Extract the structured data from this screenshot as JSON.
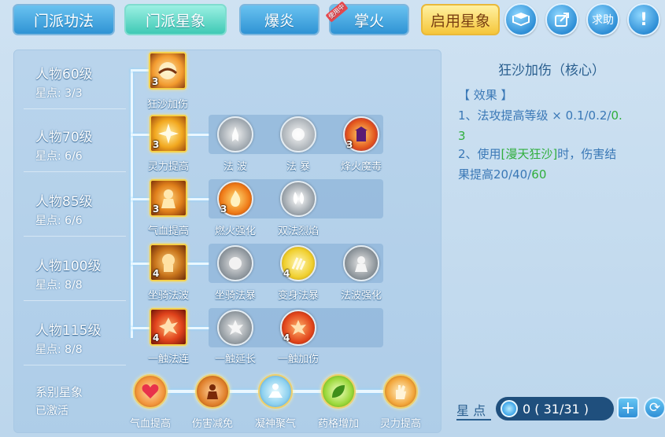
{
  "tabs": [
    {
      "label": "门派功法",
      "state": "normal"
    },
    {
      "label": "门派星象",
      "state": "active"
    },
    {
      "label": "爆炎",
      "state": "normal"
    },
    {
      "label": "掌火",
      "state": "normal",
      "ribbon": "使用中"
    },
    {
      "label": "启用星象",
      "state": "gold"
    }
  ],
  "top_buttons": {
    "book_icon": "book-icon",
    "share_icon": "share-icon",
    "help_label": "求助",
    "info_label": "!"
  },
  "levels": [
    {
      "name": "人物60级",
      "stars": "星点: 3/3"
    },
    {
      "name": "人物70级",
      "stars": "星点: 6/6"
    },
    {
      "name": "人物85级",
      "stars": "星点: 6/6"
    },
    {
      "name": "人物100级",
      "stars": "星点: 8/8"
    },
    {
      "name": "人物115级",
      "stars": "星点: 8/8"
    }
  ],
  "row1": {
    "skill": {
      "label": "狂沙加伤",
      "count": "3"
    }
  },
  "row2": {
    "main": {
      "label": "灵力提高",
      "count": "3"
    },
    "subs": [
      {
        "label": "法 波",
        "count": ""
      },
      {
        "label": "法 暴",
        "count": ""
      },
      {
        "label": "烽火魔毒",
        "count": "3"
      }
    ]
  },
  "row3": {
    "main": {
      "label": "气血提高",
      "count": "3"
    },
    "subs": [
      {
        "label": "燃火强化",
        "count": "3"
      },
      {
        "label": "双法烈焰",
        "count": ""
      }
    ]
  },
  "row4": {
    "main": {
      "label": "坐骑法波",
      "count": "4"
    },
    "subs": [
      {
        "label": "坐骑法暴",
        "count": ""
      },
      {
        "label": "变身法暴",
        "count": "4"
      },
      {
        "label": "法波强化",
        "count": ""
      }
    ]
  },
  "row5": {
    "main": {
      "label": "一触法连",
      "count": "4"
    },
    "subs": [
      {
        "label": "一触延长",
        "count": ""
      },
      {
        "label": "一触加伤",
        "count": "4"
      }
    ]
  },
  "system": {
    "name": "系别星象",
    "status": "已激活",
    "orbs": [
      "气血提高",
      "伤害减免",
      "凝神聚气",
      "药格增加",
      "灵力提高"
    ]
  },
  "detail": {
    "title": "狂沙加伤（核心）",
    "effect_header": "【 效果 】",
    "line1_a": "1、法攻提高等级 × 0.1/0.2/",
    "line1_b": "0.",
    "line1_c": "3",
    "line2_a": "2、使用",
    "line2_skill": "[漫天狂沙]",
    "line2_b": "时，伤害结",
    "line3_a": "果提高20/40/",
    "line3_b": "60"
  },
  "star_points": {
    "label": "星 点",
    "value": "0 ( 31/31 )",
    "plus": "+",
    "refresh": "⟳"
  },
  "colors": {
    "tab_blue": "#2f93d4",
    "tab_active": "#3fc9b5",
    "tab_gold": "#f5c63b",
    "detail_text": "#3a78b6",
    "highlight": "#2fae3c"
  }
}
